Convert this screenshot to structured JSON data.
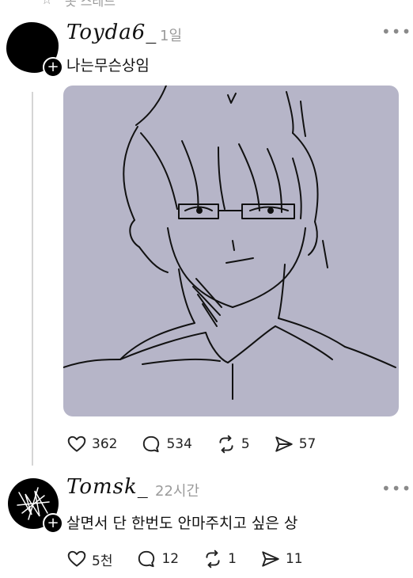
{
  "top_bar": {
    "label": "옷 스레드"
  },
  "posts": [
    {
      "username": "Toyda6_",
      "time": "1일",
      "text": "나는무슨상임",
      "stats": {
        "likes": "362",
        "replies": "534",
        "reposts": "5",
        "shares": "57"
      }
    },
    {
      "username": "Tomsk_",
      "time": "22시간",
      "text": "살면서 단 한번도 안마주치고 싶은 상",
      "stats": {
        "likes": "5천",
        "replies": "12",
        "reposts": "1",
        "shares": "11"
      }
    }
  ],
  "colors": {
    "drawing_background": "#b6b5c8",
    "muted_text": "#9b9b9b",
    "thread_line": "#d5d5d5"
  },
  "icons": {
    "like": "heart-icon",
    "reply": "comment-bubble-icon",
    "repost": "repost-icon",
    "share": "send-icon",
    "more": "more-dots-icon",
    "follow": "plus-badge-icon"
  }
}
